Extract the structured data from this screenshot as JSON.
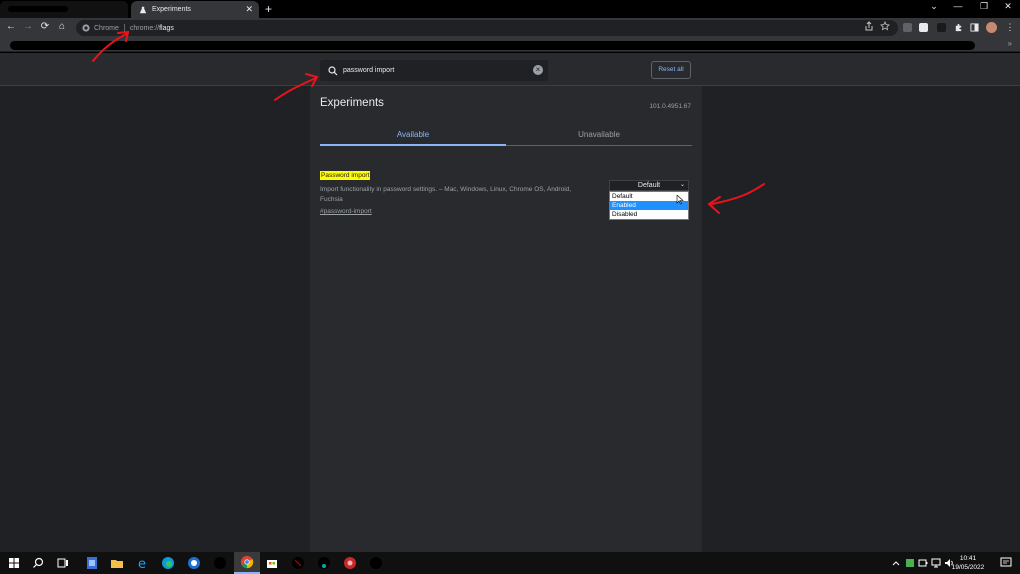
{
  "browser": {
    "active_tab_title": "Experiments",
    "new_tab_symbol": "+",
    "tab_close_symbol": "✕",
    "window_controls": {
      "dropdown": "⌄",
      "minimize": "—",
      "restore": "❐",
      "close": "✕"
    },
    "nav": {
      "back": "←",
      "forward": "→",
      "reload": "⟳",
      "home": "⌂"
    },
    "omnibox": {
      "chip_label": "Chrome",
      "url_scheme": "chrome://",
      "url_path": "flags"
    },
    "bookmarks_overflow": "»"
  },
  "flags_page": {
    "search_query": "password import",
    "reset_all_label": "Reset all",
    "title": "Experiments",
    "version": "101.0.4951.67",
    "tabs": {
      "available": "Available",
      "unavailable": "Unavailable"
    },
    "flag": {
      "name": "Password import",
      "description": "Import functionality in password settings. – Mac, Windows, Linux, Chrome OS, Android, Fuchsia",
      "link": "#password-import",
      "select_value": "Default",
      "options": [
        "Default",
        "Enabled",
        "Disabled"
      ],
      "highlighted_option": "Enabled"
    }
  },
  "taskbar": {
    "time": "10:41",
    "date": "19/05/2022"
  },
  "colors": {
    "accent": "#8ab4f8",
    "highlight": "#ffff00",
    "annotation": "#e8141c"
  }
}
